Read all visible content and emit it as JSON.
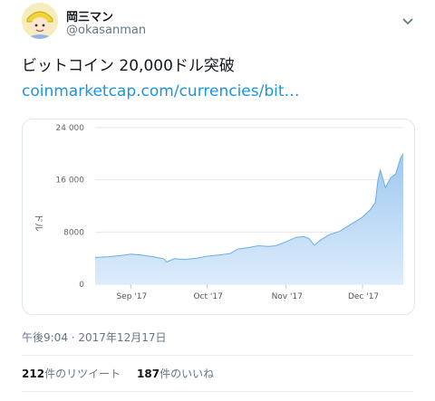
{
  "user": {
    "name": "岡三マン",
    "handle": "@okasanman"
  },
  "tweet": {
    "text": "ビットコイン 20,000ドル突破",
    "link": "coinmarketcap.com/currencies/bit…",
    "timestamp": "午後9:04 · 2017年12月17日"
  },
  "stats": {
    "retweets_count": "212",
    "retweets_label": "件のリツイート",
    "likes_count": "187",
    "likes_label": "件のいいね"
  },
  "icons": {
    "menu": "chevron-down-icon",
    "avatar": "avatar"
  },
  "colors": {
    "area_fill": "#a8cdf0",
    "area_line": "#6aaee8",
    "link": "#1b95e0"
  },
  "chart_data": {
    "type": "area",
    "ylabel": "ドル",
    "ylim": [
      0,
      24000
    ],
    "yticks": [
      0,
      8000,
      16000,
      24000
    ],
    "ytick_labels": [
      "0",
      "8000",
      "16 000",
      "24 000"
    ],
    "xtick_labels": [
      "Sep '17",
      "Oct '17",
      "Nov '17",
      "Dec '17"
    ],
    "xlim": [
      "2017-08-18",
      "2017-12-17"
    ],
    "grid": true,
    "series": [
      {
        "x": [
          "2017-08-18",
          "2017-08-23",
          "2017-08-28",
          "2017-09-01",
          "2017-09-05",
          "2017-09-10",
          "2017-09-14",
          "2017-09-15",
          "2017-09-18",
          "2017-09-22",
          "2017-09-27",
          "2017-10-01",
          "2017-10-06",
          "2017-10-10",
          "2017-10-13",
          "2017-10-17",
          "2017-10-21",
          "2017-10-25",
          "2017-10-28",
          "2017-11-01",
          "2017-11-05",
          "2017-11-08",
          "2017-11-10",
          "2017-11-12",
          "2017-11-15",
          "2017-11-18",
          "2017-11-22",
          "2017-11-26",
          "2017-11-29",
          "2017-12-01",
          "2017-12-04",
          "2017-12-06",
          "2017-12-07",
          "2017-12-08",
          "2017-12-10",
          "2017-12-12",
          "2017-12-14",
          "2017-12-16",
          "2017-12-17"
        ],
        "values": [
          4100,
          4200,
          4400,
          4600,
          4500,
          4200,
          3900,
          3400,
          3900,
          3800,
          4000,
          4300,
          4500,
          4700,
          5400,
          5600,
          5900,
          5800,
          5900,
          6500,
          7200,
          7300,
          7000,
          6000,
          6900,
          7600,
          8100,
          9100,
          9800,
          10300,
          11400,
          12500,
          15800,
          17500,
          14800,
          16300,
          16900,
          19400,
          20000
        ]
      }
    ]
  }
}
